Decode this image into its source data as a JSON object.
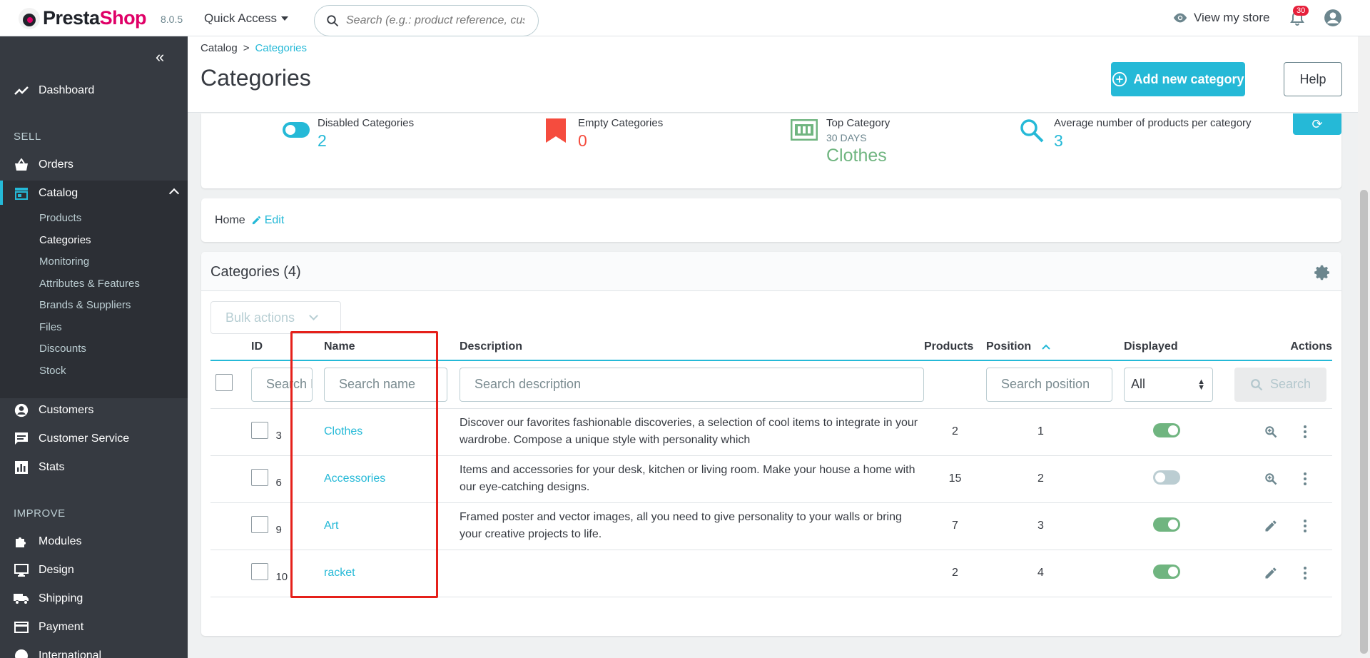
{
  "header": {
    "logo_prefix": "Presta",
    "logo_suffix": "Shop",
    "version": "8.0.5",
    "quick_access": "Quick Access",
    "search_placeholder": "Search (e.g.: product reference, custon",
    "view_store": "View my store",
    "notifications_count": "30"
  },
  "sidebar": {
    "dashboard": "Dashboard",
    "sell_section": "SELL",
    "orders": "Orders",
    "catalog": "Catalog",
    "catalog_items": [
      "Products",
      "Categories",
      "Monitoring",
      "Attributes & Features",
      "Brands & Suppliers",
      "Files",
      "Discounts",
      "Stock"
    ],
    "customers": "Customers",
    "customer_service": "Customer Service",
    "stats": "Stats",
    "improve_section": "IMPROVE",
    "modules": "Modules",
    "design": "Design",
    "shipping": "Shipping",
    "payment": "Payment",
    "international": "International"
  },
  "page": {
    "breadcrumb_parent": "Catalog",
    "breadcrumb_sep": ">",
    "breadcrumb_current": "Categories",
    "title": "Categories",
    "add_button": "Add new category",
    "help_button": "Help"
  },
  "kpis": {
    "disabled_label": "Disabled Categories",
    "disabled_value": "2",
    "empty_label": "Empty Categories",
    "empty_value": "0",
    "top_label": "Top Category",
    "top_sub": "30 DAYS",
    "top_value": "Clothes",
    "avg_label": "Average number of products per category",
    "avg_value": "3"
  },
  "home_crumb": {
    "home": "Home",
    "edit": "Edit"
  },
  "grid": {
    "title": "Categories (4)",
    "bulk_actions": "Bulk actions",
    "columns": {
      "id": "ID",
      "name": "Name",
      "description": "Description",
      "products": "Products",
      "position": "Position",
      "displayed": "Displayed",
      "actions": "Actions"
    },
    "filters": {
      "id_placeholder": "Search ID",
      "name_placeholder": "Search name",
      "description_placeholder": "Search description",
      "position_placeholder": "Search position",
      "displayed_value": "All",
      "search_button": "Search"
    },
    "rows": [
      {
        "id": "3",
        "name": "Clothes",
        "description": "Discover our favorites fashionable discoveries, a selection of cool items to integrate in your wardrobe. Compose a unique style with personality which",
        "products": "2",
        "position": "1",
        "displayed": true,
        "action": "view"
      },
      {
        "id": "6",
        "name": "Accessories",
        "description": "Items and accessories for your desk, kitchen or living room. Make your house a home with our eye-catching designs.",
        "products": "15",
        "position": "2",
        "displayed": false,
        "action": "view"
      },
      {
        "id": "9",
        "name": "Art",
        "description": "Framed poster and vector images, all you need to give personality to your walls or bring your creative projects to life.",
        "products": "7",
        "position": "3",
        "displayed": true,
        "action": "edit"
      },
      {
        "id": "10",
        "name": "racket",
        "description": "",
        "products": "2",
        "position": "4",
        "displayed": true,
        "action": "edit"
      }
    ]
  },
  "colors": {
    "accent": "#25b9d7",
    "danger": "#e5201a",
    "success": "#70b580",
    "sidebar": "#363a41"
  }
}
